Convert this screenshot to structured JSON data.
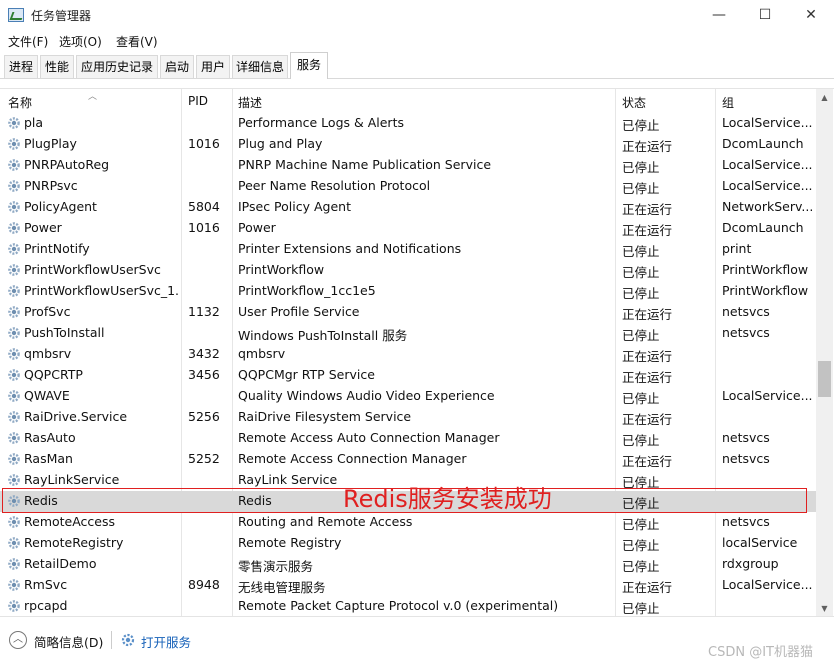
{
  "window": {
    "title": "任务管理器",
    "buttons": {
      "minimize": "—",
      "maximize": "☐",
      "close": "✕"
    }
  },
  "menu": [
    "文件(F)",
    "选项(O)",
    "查看(V)"
  ],
  "tabs": [
    "进程",
    "性能",
    "应用历史记录",
    "启动",
    "用户",
    "详细信息",
    "服务"
  ],
  "active_tab": "服务",
  "columns": {
    "name": "名称",
    "pid": "PID",
    "desc": "描述",
    "status": "状态",
    "group": "组"
  },
  "services": [
    {
      "name": "pla",
      "pid": "",
      "desc": "Performance Logs & Alerts",
      "status": "已停止",
      "group": "LocalService..."
    },
    {
      "name": "PlugPlay",
      "pid": "1016",
      "desc": "Plug and Play",
      "status": "正在运行",
      "group": "DcomLaunch"
    },
    {
      "name": "PNRPAutoReg",
      "pid": "",
      "desc": "PNRP Machine Name Publication Service",
      "status": "已停止",
      "group": "LocalService..."
    },
    {
      "name": "PNRPsvc",
      "pid": "",
      "desc": "Peer Name Resolution Protocol",
      "status": "已停止",
      "group": "LocalService..."
    },
    {
      "name": "PolicyAgent",
      "pid": "5804",
      "desc": "IPsec Policy Agent",
      "status": "正在运行",
      "group": "NetworkServ..."
    },
    {
      "name": "Power",
      "pid": "1016",
      "desc": "Power",
      "status": "正在运行",
      "group": "DcomLaunch"
    },
    {
      "name": "PrintNotify",
      "pid": "",
      "desc": "Printer Extensions and Notifications",
      "status": "已停止",
      "group": "print"
    },
    {
      "name": "PrintWorkflowUserSvc",
      "pid": "",
      "desc": "PrintWorkflow",
      "status": "已停止",
      "group": "PrintWorkflow"
    },
    {
      "name": "PrintWorkflowUserSvc_1...",
      "pid": "",
      "desc": "PrintWorkflow_1cc1e5",
      "status": "已停止",
      "group": "PrintWorkflow"
    },
    {
      "name": "ProfSvc",
      "pid": "1132",
      "desc": "User Profile Service",
      "status": "正在运行",
      "group": "netsvcs"
    },
    {
      "name": "PushToInstall",
      "pid": "",
      "desc": "Windows PushToInstall 服务",
      "status": "已停止",
      "group": "netsvcs"
    },
    {
      "name": "qmbsrv",
      "pid": "3432",
      "desc": "qmbsrv",
      "status": "正在运行",
      "group": ""
    },
    {
      "name": "QQPCRTP",
      "pid": "3456",
      "desc": "QQPCMgr RTP Service",
      "status": "正在运行",
      "group": ""
    },
    {
      "name": "QWAVE",
      "pid": "",
      "desc": "Quality Windows Audio Video Experience",
      "status": "已停止",
      "group": "LocalService..."
    },
    {
      "name": "RaiDrive.Service",
      "pid": "5256",
      "desc": "RaiDrive Filesystem Service",
      "status": "正在运行",
      "group": ""
    },
    {
      "name": "RasAuto",
      "pid": "",
      "desc": "Remote Access Auto Connection Manager",
      "status": "已停止",
      "group": "netsvcs"
    },
    {
      "name": "RasMan",
      "pid": "5252",
      "desc": "Remote Access Connection Manager",
      "status": "正在运行",
      "group": "netsvcs"
    },
    {
      "name": "RayLinkService",
      "pid": "",
      "desc": "RayLink Service",
      "status": "已停止",
      "group": ""
    },
    {
      "name": "Redis",
      "pid": "",
      "desc": "Redis",
      "status": "已停止",
      "group": ""
    },
    {
      "name": "RemoteAccess",
      "pid": "",
      "desc": "Routing and Remote Access",
      "status": "已停止",
      "group": "netsvcs"
    },
    {
      "name": "RemoteRegistry",
      "pid": "",
      "desc": "Remote Registry",
      "status": "已停止",
      "group": "localService"
    },
    {
      "name": "RetailDemo",
      "pid": "",
      "desc": "零售演示服务",
      "status": "已停止",
      "group": "rdxgroup"
    },
    {
      "name": "RmSvc",
      "pid": "8948",
      "desc": "无线电管理服务",
      "status": "正在运行",
      "group": "LocalService..."
    },
    {
      "name": "rpcapd",
      "pid": "",
      "desc": "Remote Packet Capture Protocol v.0 (experimental)",
      "status": "已停止",
      "group": ""
    }
  ],
  "selected_service": "Redis",
  "annotation": "Redis服务安装成功",
  "footer": {
    "fewer_details": "简略信息(D)",
    "open_services": "打开服务"
  },
  "watermark": "CSDN @IT机器猫",
  "colors": {
    "annotation": "#e02020",
    "link": "#1560b8",
    "selected_row": "#d9d9d9"
  }
}
